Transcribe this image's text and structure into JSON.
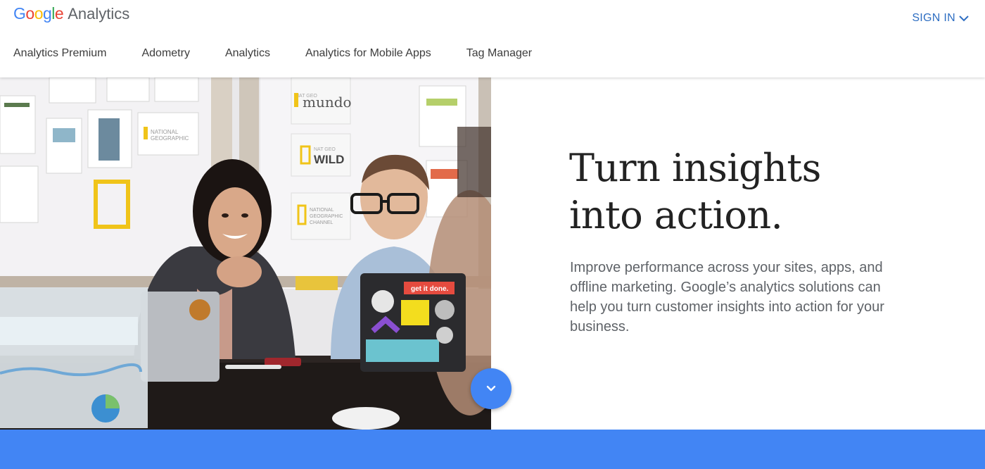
{
  "header": {
    "logo": {
      "letters": [
        {
          "char": "G",
          "color": "#4285F4"
        },
        {
          "char": "o",
          "color": "#EA4335"
        },
        {
          "char": "o",
          "color": "#FBBC05"
        },
        {
          "char": "g",
          "color": "#4285F4"
        },
        {
          "char": "l",
          "color": "#34A853"
        },
        {
          "char": "e",
          "color": "#EA4335"
        }
      ],
      "product": "Analytics"
    },
    "signin_label": "SIGN IN",
    "signin_icon": "chevron-down-icon",
    "nav_items": [
      {
        "label": "Analytics Premium"
      },
      {
        "label": "Adometry"
      },
      {
        "label": "Analytics"
      },
      {
        "label": "Analytics for Mobile Apps"
      },
      {
        "label": "Tag Manager"
      }
    ]
  },
  "hero": {
    "headline_line1": "Turn insights",
    "headline_line2": "into action.",
    "subtext": "Improve performance across your sites, apps, and offline marketing. Google’s analytics solutions can help you turn customer insights into action for your business.",
    "image_description": "office-meeting-photo",
    "image_signs": {
      "sign1_small": "NAT GEO",
      "sign1_big": "mundo",
      "sign2_small": "NAT GEO",
      "sign2_big": "WILD",
      "sign3_line1": "NATIONAL",
      "sign3_line2": "GEOGRAPHIC",
      "sign4_line1": "NATIONAL",
      "sign4_line2": "GEOGRAPHIC",
      "sign4_line3": "CHANNEL",
      "laptop_sticker": "get it done."
    },
    "scroll_icon": "chevron-down-icon"
  },
  "colors": {
    "brand_blue": "#4285f4",
    "signin_blue": "#2e6ec2",
    "headline": "#222222",
    "body_text": "#5f6368"
  }
}
